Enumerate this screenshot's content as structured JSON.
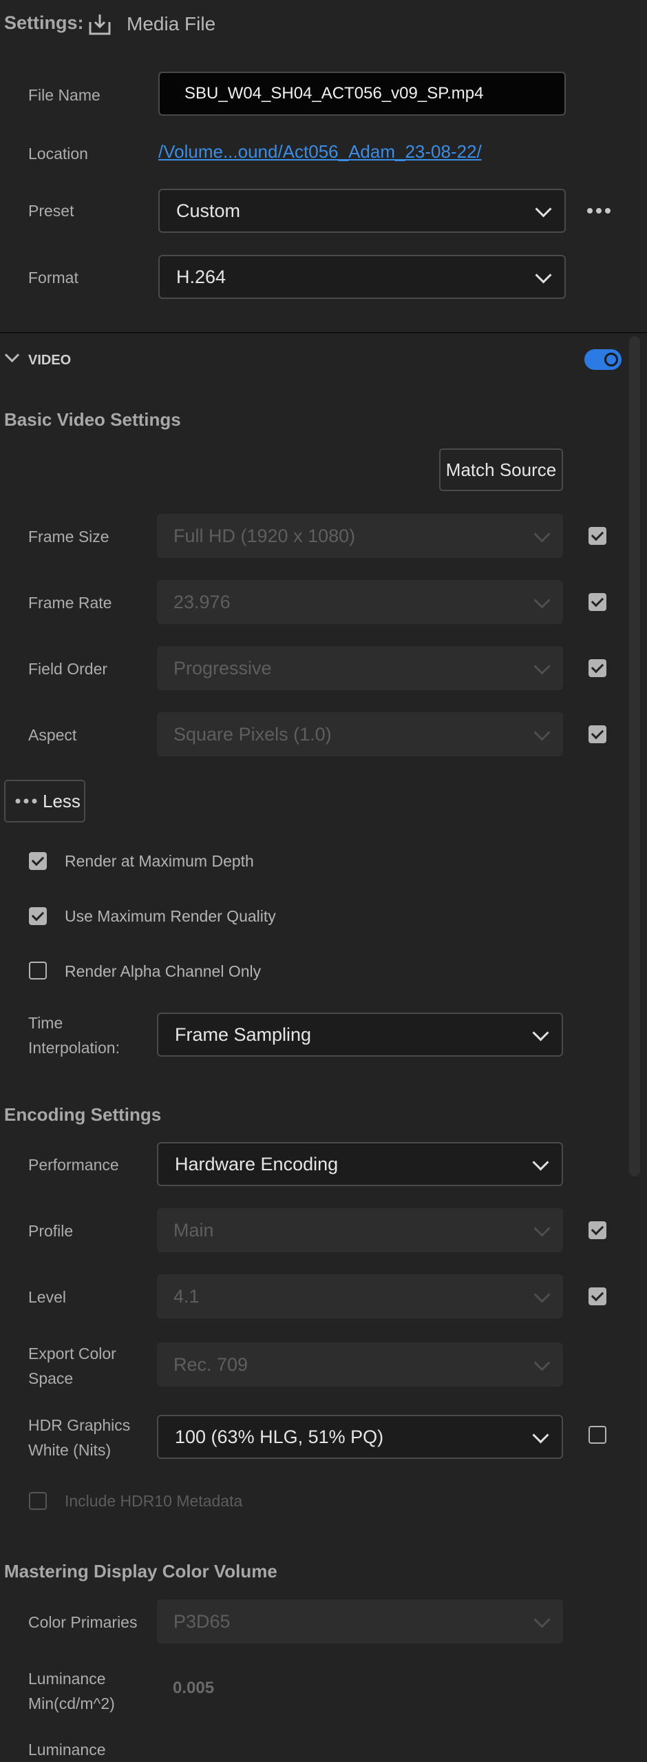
{
  "header": {
    "settings_label": "Settings:",
    "icon": "download-icon",
    "tab_label": "Media File"
  },
  "file": {
    "file_name_label": "File Name",
    "file_name_value": "SBU_W04_SH04_ACT056_v09_SP.mp4",
    "location_label": "Location",
    "location_value": "/Volume...ound/Act056_Adam_23-08-22/",
    "preset_label": "Preset",
    "preset_value": "Custom",
    "format_label": "Format",
    "format_value": "H.264"
  },
  "video": {
    "section_label": "VIDEO",
    "enabled": true,
    "basic_title": "Basic Video Settings",
    "match_source_label": "Match Source",
    "frame_size_label": "Frame Size",
    "frame_size_value": "Full HD (1920 x 1080)",
    "frame_rate_label": "Frame Rate",
    "frame_rate_value": "23.976",
    "field_order_label": "Field Order",
    "field_order_value": "Progressive",
    "aspect_label": "Aspect",
    "aspect_value": "Square Pixels (1.0)",
    "less_label": "Less",
    "render_max_depth_label": "Render at Maximum Depth",
    "render_max_depth": true,
    "max_render_quality_label": "Use Maximum Render Quality",
    "max_render_quality": true,
    "alpha_only_label": "Render Alpha Channel Only",
    "alpha_only": false,
    "time_interp_label_1": "Time",
    "time_interp_label_2": "Interpolation:",
    "time_interp_value": "Frame Sampling"
  },
  "encoding": {
    "title": "Encoding Settings",
    "performance_label": "Performance",
    "performance_value": "Hardware Encoding",
    "profile_label": "Profile",
    "profile_value": "Main",
    "level_label": "Level",
    "level_value": "4.1",
    "color_space_label_1": "Export Color",
    "color_space_label_2": "Space",
    "color_space_value": "Rec. 709",
    "hdr_white_label_1": "HDR Graphics",
    "hdr_white_label_2": "White (Nits)",
    "hdr_white_value": "100 (63% HLG, 51% PQ)",
    "hdr10_label": "Include HDR10 Metadata"
  },
  "mastering": {
    "title": "Mastering Display Color Volume",
    "color_primaries_label": "Color Primaries",
    "color_primaries_value": "P3D65",
    "luminance_min_label_1": "Luminance",
    "luminance_min_label_2": "Min(cd/m^2)",
    "luminance_min_value": "0.005",
    "luminance_max_label_partial": "Luminance"
  },
  "colors": {
    "background": "#232323",
    "accent_toggle": "#2c7be5",
    "link": "#3a8ee6"
  }
}
